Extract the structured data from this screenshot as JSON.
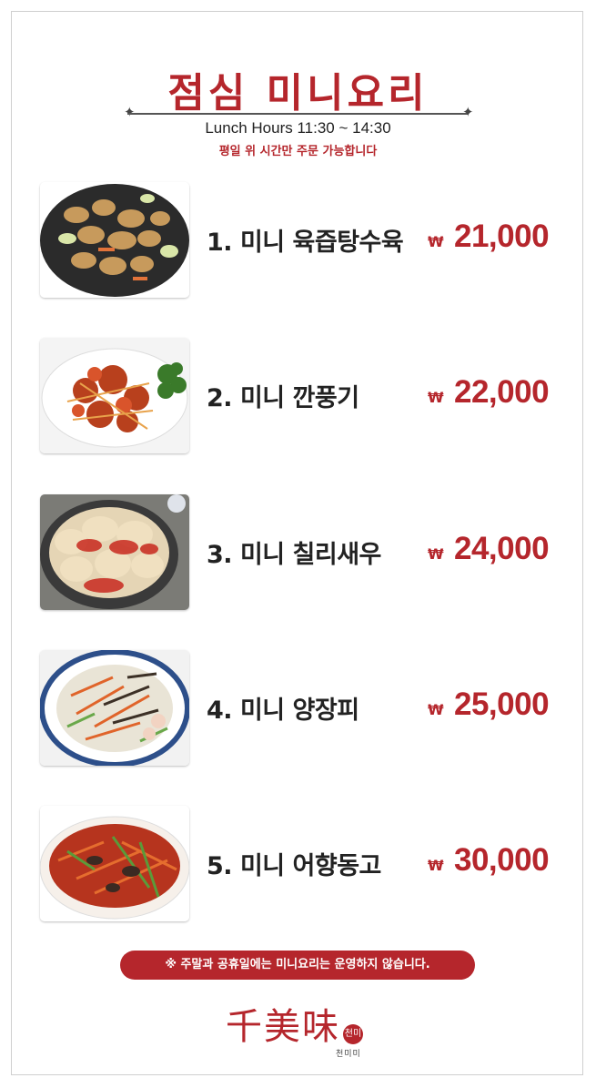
{
  "header": {
    "title": "점심 미니요리",
    "lunch_hours": "Lunch Hours 11:30 ~ 14:30",
    "weekday_notice": "평일 위 시간만 주문 가능합니다"
  },
  "menu": [
    {
      "name": "1. 미니 육즙탕수육",
      "currency": "₩",
      "price": "21,000"
    },
    {
      "name": "2. 미니 깐풍기",
      "currency": "₩",
      "price": "22,000"
    },
    {
      "name": "3. 미니 칠리새우",
      "currency": "₩",
      "price": "24,000"
    },
    {
      "name": "4. 미니 양장피",
      "currency": "₩",
      "price": "25,000"
    },
    {
      "name": "5. 미니 어향동고",
      "currency": "₩",
      "price": "30,000"
    }
  ],
  "footer": {
    "closed_notice": "※ 주말과 공휴일에는 미니요리는 운영하지 않습니다.",
    "brand_hanja": "千美味",
    "brand_korean": "천미미",
    "seal_text": "천미"
  },
  "colors": {
    "accent": "#b5262c",
    "text": "#222222"
  },
  "icons": [
    "fried-pork-photo",
    "kkanpunggi-photo",
    "chili-shrimp-photo",
    "yangjangpi-photo",
    "eohyang-donggo-photo"
  ]
}
